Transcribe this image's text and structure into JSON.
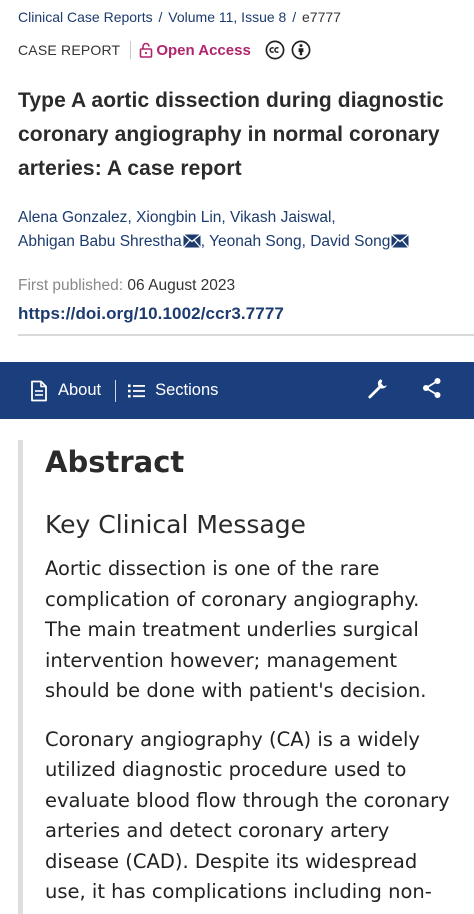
{
  "breadcrumb": {
    "journal": "Clinical Case Reports",
    "volume": "Volume 11, Issue 8",
    "article_id": "e7777"
  },
  "meta": {
    "article_type": "CASE REPORT",
    "access": "Open Access"
  },
  "article": {
    "title": "Type A aortic dissection during diagnostic coronary angiography in normal coronary arteries: A case report",
    "authors": [
      {
        "name": "Alena Gonzalez",
        "corresponding": false
      },
      {
        "name": "Xiongbin Lin",
        "corresponding": false
      },
      {
        "name": "Vikash Jaiswal",
        "corresponding": false
      },
      {
        "name": "Abhigan Babu Shrestha",
        "corresponding": true
      },
      {
        "name": "Yeonah Song",
        "corresponding": false
      },
      {
        "name": "David Song",
        "corresponding": true
      }
    ],
    "published_label": "First published:",
    "published_date": "06 August 2023",
    "doi": "https://doi.org/10.1002/ccr3.7777"
  },
  "nav": {
    "about_label": "About",
    "sections_label": "Sections"
  },
  "content": {
    "abstract_heading": "Abstract",
    "kcm_heading": "Key Clinical Message",
    "paragraphs": [
      "Aortic dissection is one of the rare complication of coronary angiography. The main treatment underlies surgical intervention however; management should be done with patient's decision.",
      "Coronary angiography (CA) is a widely utilized diagnostic procedure used to evaluate blood flow through the coronary arteries and detect coronary artery disease (CAD). Despite its widespread use, it has complications including non-life-threatening and life-threatening"
    ]
  },
  "colors": {
    "navy": "#1b3f7c",
    "link": "#1c3b6e",
    "open_access": "#b0256b"
  }
}
